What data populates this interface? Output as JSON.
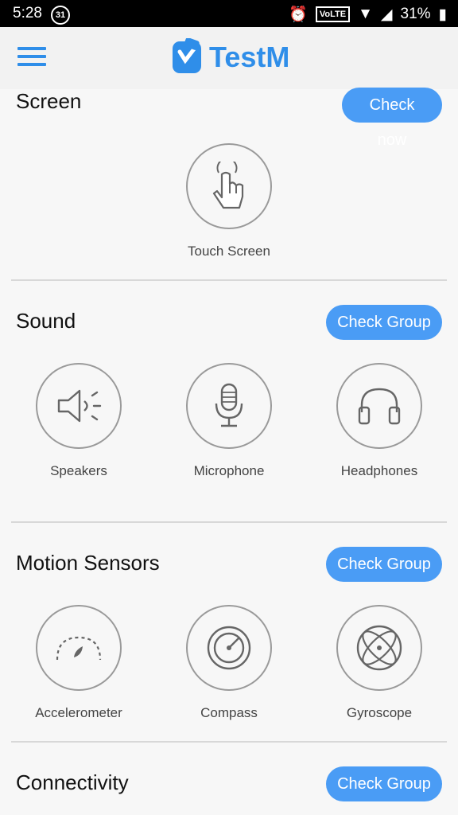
{
  "status": {
    "time": "5:28",
    "calendar": "31",
    "volte": "VoLTE",
    "battery": "31%"
  },
  "app": {
    "name": "TestM"
  },
  "screen": {
    "title": "Screen",
    "button": "Check now",
    "items": [
      {
        "label": "Touch Screen",
        "icon": "touch-icon"
      }
    ]
  },
  "sound": {
    "title": "Sound",
    "button": "Check Group",
    "items": [
      {
        "label": "Speakers",
        "icon": "speaker-icon"
      },
      {
        "label": "Microphone",
        "icon": "microphone-icon"
      },
      {
        "label": "Headphones",
        "icon": "headphones-icon"
      }
    ]
  },
  "motion": {
    "title": "Motion Sensors",
    "button": "Check Group",
    "items": [
      {
        "label": "Accelerometer",
        "icon": "speedometer-icon"
      },
      {
        "label": "Compass",
        "icon": "compass-icon"
      },
      {
        "label": "Gyroscope",
        "icon": "gyroscope-icon"
      }
    ]
  },
  "connectivity": {
    "title": "Connectivity",
    "button": "Check Group"
  },
  "colors": {
    "accent": "#2f8ee9",
    "button": "#4a9cf5"
  }
}
